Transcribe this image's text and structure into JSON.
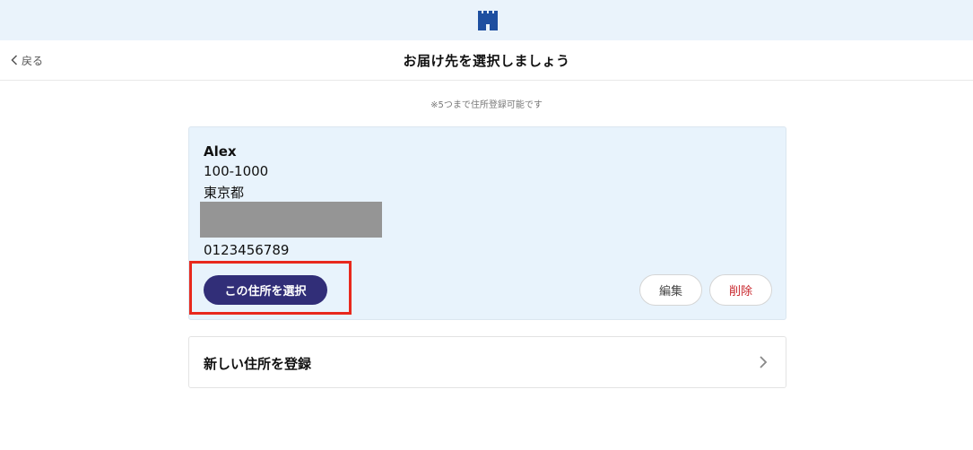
{
  "header": {
    "back_label": "戻る",
    "title": "お届け先を選択しましょう"
  },
  "note": "※5つまで住所登録可能です",
  "address": {
    "name": "Alex",
    "postal": "100-1000",
    "prefecture": "東京都",
    "phone": "0123456789",
    "select_label": "この住所を選択",
    "edit_label": "編集",
    "delete_label": "削除"
  },
  "new_address_label": "新しい住所を登録",
  "colors": {
    "topbar_bg": "#eaf3fb",
    "card_bg": "#e8f3fc",
    "primary": "#312e78",
    "delete": "#c8252b",
    "highlight": "#e8291d",
    "logo": "#1e4fa0"
  },
  "icons": {
    "logo": "castle-icon",
    "back": "chevron-left-icon",
    "next": "chevron-right-icon"
  }
}
